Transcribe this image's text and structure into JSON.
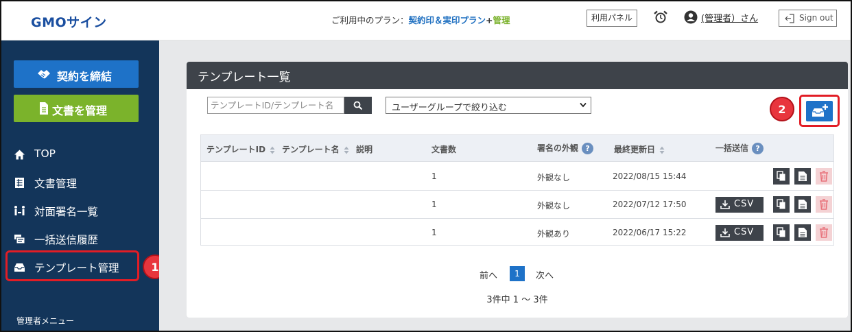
{
  "header": {
    "logo": "GMOサイン",
    "plan_prefix": "ご利用中のプラン：",
    "plan_name": "契約印＆実印プラン",
    "plan_plus": "+",
    "plan_addon": "管理",
    "panel_label": "利用パネル",
    "user_name": "(管理者）さん",
    "signout_label": "Sign out"
  },
  "sidebar": {
    "contract_label": "契約を締結",
    "docs_label": "文書を管理",
    "items": [
      {
        "label": "TOP",
        "icon": "home-icon"
      },
      {
        "label": "文書管理",
        "icon": "document-list-icon"
      },
      {
        "label": "対面署名一覧",
        "icon": "face-sign-icon"
      },
      {
        "label": "一括送信履歴",
        "icon": "bulk-send-icon"
      },
      {
        "label": "テンプレート管理",
        "icon": "tray-icon"
      }
    ],
    "admin_menu": "管理者メニュー",
    "badge1": "1"
  },
  "main": {
    "title": "テンプレート一覧",
    "search_placeholder": "テンプレートID/テンプレート名",
    "group_select": "ユーザーグループで絞り込む",
    "badge2": "2",
    "columns": {
      "id": "テンプレートID",
      "name": "テンプレート名",
      "desc": "説明",
      "count": "文書数",
      "appearance": "署名の外観",
      "updated": "最終更新日",
      "bulk": "一括送信"
    },
    "rows": [
      {
        "count": "1",
        "appearance": "外観なし",
        "updated": "2022/08/15 15:44",
        "csv": ""
      },
      {
        "count": "1",
        "appearance": "外観なし",
        "updated": "2022/07/12 17:50",
        "csv": "CSV"
      },
      {
        "count": "1",
        "appearance": "外観あり",
        "updated": "2022/06/17 15:22",
        "csv": "CSV"
      }
    ],
    "pager": {
      "prev": "前へ",
      "current": "1",
      "next": "次へ",
      "info": "3件中 1 ～ 3件"
    }
  },
  "colors": {
    "sidebar": "#13355a",
    "primary": "#1e72c8",
    "green": "#7bb32b",
    "dark": "#3e434a",
    "highlight": "#e21d25"
  }
}
